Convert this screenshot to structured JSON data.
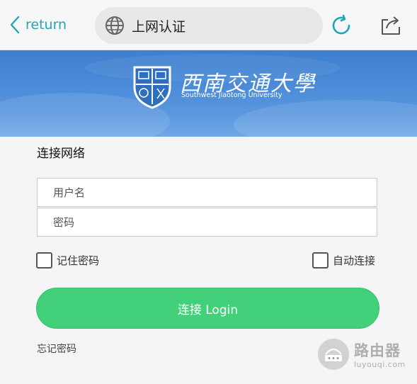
{
  "topbar": {
    "back_label": "return",
    "page_title": "上网认证"
  },
  "banner": {
    "university_cn": "西南交通大學",
    "university_en": "Southwest Jiaotong University"
  },
  "form": {
    "heading": "连接网络",
    "username_placeholder": "用户名",
    "password_placeholder": "密码",
    "remember_label": "记住密码",
    "auto_connect_label": "自动连接",
    "login_label": "连接 Login",
    "forgot_label": "忘记密码"
  },
  "watermark": {
    "name": "路由器",
    "url": "luyouqi.com"
  },
  "colors": {
    "accent": "#1fa7b8",
    "login_button": "#43d07a",
    "banner": "#4a8ad8"
  }
}
